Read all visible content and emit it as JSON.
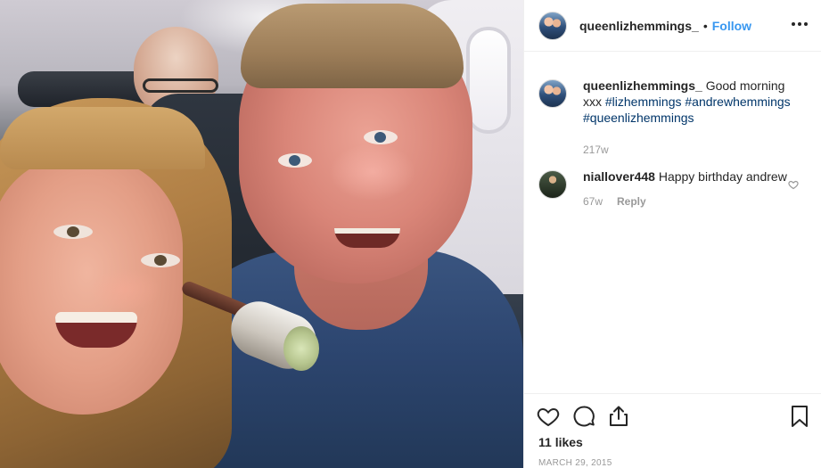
{
  "post": {
    "username": "queenlizhemmings_",
    "separator": "•",
    "follow_label": "Follow"
  },
  "caption": {
    "username": "queenlizhemmings_",
    "text": "Good morning xxx",
    "hashtags": [
      "#lizhemmings",
      "#andrewhemmings",
      "#queenlizhemmings"
    ],
    "age": "217w"
  },
  "comments": [
    {
      "username": "niallover448",
      "text": "Happy birthday andrew",
      "age": "67w",
      "reply_label": "Reply"
    }
  ],
  "likes": "11 likes",
  "date": "MARCH 29, 2015",
  "icons": {
    "more": "more-options-icon",
    "like": "heart-icon",
    "comment": "comment-icon",
    "share": "share-icon",
    "save": "bookmark-icon",
    "comment_like": "heart-small-icon"
  },
  "colors": {
    "follow": "#3897f0",
    "hashtag": "#003569",
    "meta": "#999999",
    "text": "#262626"
  }
}
